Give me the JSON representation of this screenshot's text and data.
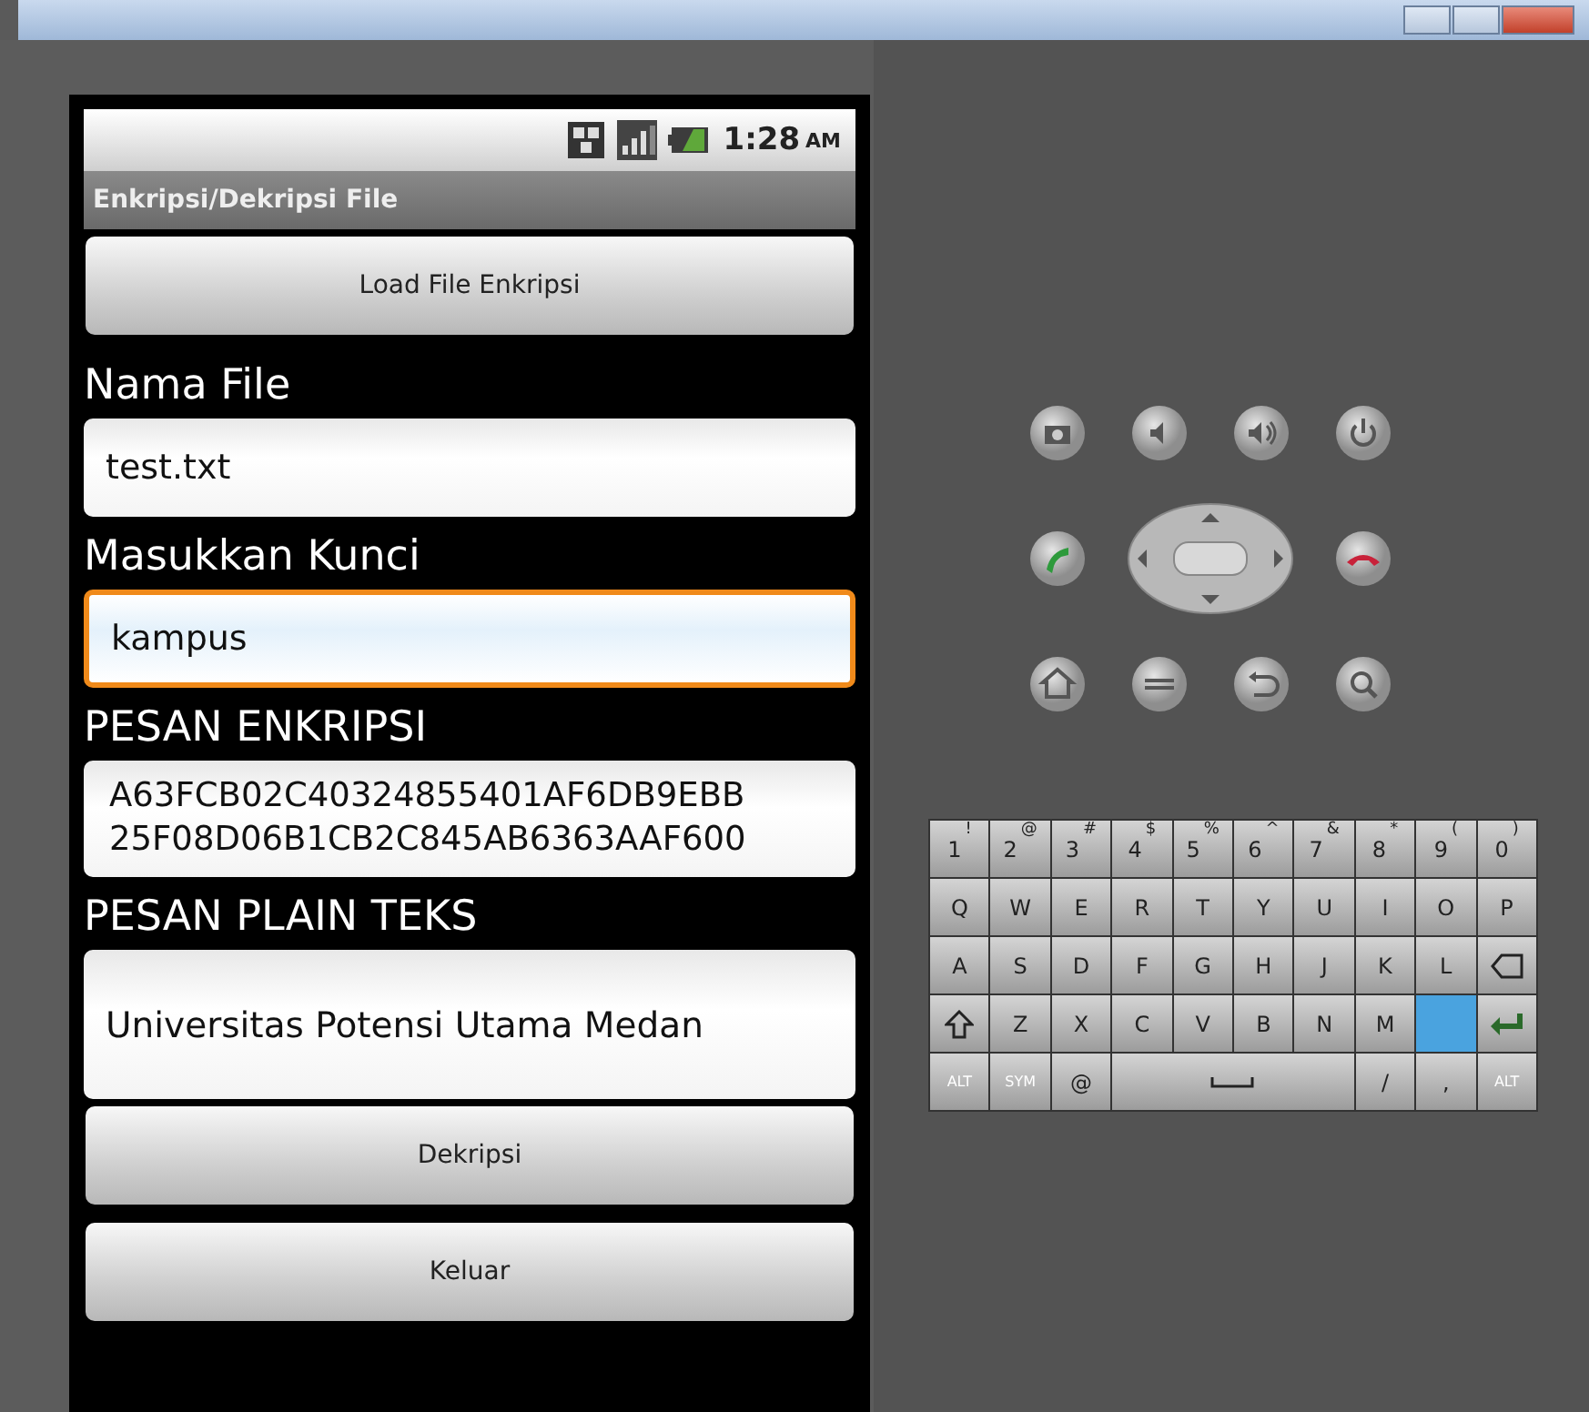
{
  "window": {
    "controls": [
      {
        "kind": "minimize"
      },
      {
        "kind": "maximize"
      },
      {
        "kind": "close"
      }
    ]
  },
  "status_bar": {
    "time": "1:28",
    "meridiem": "AM"
  },
  "app_title": "Enkripsi/Dekripsi File",
  "form": [
    {
      "kind": "button",
      "label": "Load File Enkripsi"
    },
    {
      "kind": "label",
      "text": "Nama File"
    },
    {
      "kind": "field",
      "value": "test.txt",
      "focused": false
    },
    {
      "kind": "label",
      "text": "Masukkan Kunci"
    },
    {
      "kind": "field",
      "value": "kampus",
      "focused": true
    },
    {
      "kind": "label",
      "text": "PESAN ENKRIPSI"
    },
    {
      "kind": "cipher",
      "lines": [
        "A63FCB02C40324855401AF6DB9EBB",
        "25F08D06B1CB2C845AB6363AAF600"
      ]
    },
    {
      "kind": "label",
      "text": "PESAN PLAIN TEKS"
    },
    {
      "kind": "plain",
      "value": "Universitas Potensi Utama Medan"
    },
    {
      "kind": "button",
      "label": "Dekripsi"
    },
    {
      "kind": "button",
      "label": "Keluar"
    }
  ],
  "hardware_buttons": [
    [
      {
        "kind": "camera"
      },
      {
        "kind": "volume-down"
      },
      {
        "kind": "volume-up"
      },
      {
        "kind": "power"
      }
    ],
    [
      {
        "kind": "call"
      },
      {
        "kind": "dpad"
      },
      {
        "kind": "end-call"
      }
    ],
    [
      {
        "kind": "home"
      },
      {
        "kind": "menu"
      },
      {
        "kind": "back"
      },
      {
        "kind": "search"
      }
    ]
  ],
  "keyboard": [
    [
      {
        "kind": "key",
        "label": "1",
        "sub": "!"
      },
      {
        "kind": "key",
        "label": "2",
        "sub": "@"
      },
      {
        "kind": "key",
        "label": "3",
        "sub": "#"
      },
      {
        "kind": "key",
        "label": "4",
        "sub": "$"
      },
      {
        "kind": "key",
        "label": "5",
        "sub": "%"
      },
      {
        "kind": "key",
        "label": "6",
        "sub": "^"
      },
      {
        "kind": "key",
        "label": "7",
        "sub": "&"
      },
      {
        "kind": "key",
        "label": "8",
        "sub": "*"
      },
      {
        "kind": "key",
        "label": "9",
        "sub": "("
      },
      {
        "kind": "key",
        "label": "0",
        "sub": ")"
      }
    ],
    [
      {
        "kind": "key",
        "label": "Q"
      },
      {
        "kind": "key",
        "label": "W"
      },
      {
        "kind": "key",
        "label": "E"
      },
      {
        "kind": "key",
        "label": "R"
      },
      {
        "kind": "key",
        "label": "T"
      },
      {
        "kind": "key",
        "label": "Y"
      },
      {
        "kind": "key",
        "label": "U"
      },
      {
        "kind": "key",
        "label": "I"
      },
      {
        "kind": "key",
        "label": "O"
      },
      {
        "kind": "key",
        "label": "P"
      }
    ],
    [
      {
        "kind": "key",
        "label": "A"
      },
      {
        "kind": "key",
        "label": "S"
      },
      {
        "kind": "key",
        "label": "D"
      },
      {
        "kind": "key",
        "label": "F"
      },
      {
        "kind": "key",
        "label": "G"
      },
      {
        "kind": "key",
        "label": "H"
      },
      {
        "kind": "key",
        "label": "J"
      },
      {
        "kind": "key",
        "label": "K"
      },
      {
        "kind": "key",
        "label": "L"
      },
      {
        "kind": "delete"
      }
    ],
    [
      {
        "kind": "shift"
      },
      {
        "kind": "key",
        "label": "Z"
      },
      {
        "kind": "key",
        "label": "X"
      },
      {
        "kind": "key",
        "label": "C"
      },
      {
        "kind": "key",
        "label": "V"
      },
      {
        "kind": "key",
        "label": "B"
      },
      {
        "kind": "key",
        "label": "N"
      },
      {
        "kind": "key",
        "label": "M"
      },
      {
        "kind": "blank",
        "selected": true
      },
      {
        "kind": "enter"
      }
    ],
    [
      {
        "kind": "key",
        "label": "ALT"
      },
      {
        "kind": "key",
        "label": "SYM"
      },
      {
        "kind": "key",
        "label": "@"
      },
      {
        "kind": "space"
      },
      {
        "kind": "key",
        "label": "/"
      },
      {
        "kind": "key",
        "label": ","
      },
      {
        "kind": "key",
        "label": "ALT"
      }
    ]
  ]
}
